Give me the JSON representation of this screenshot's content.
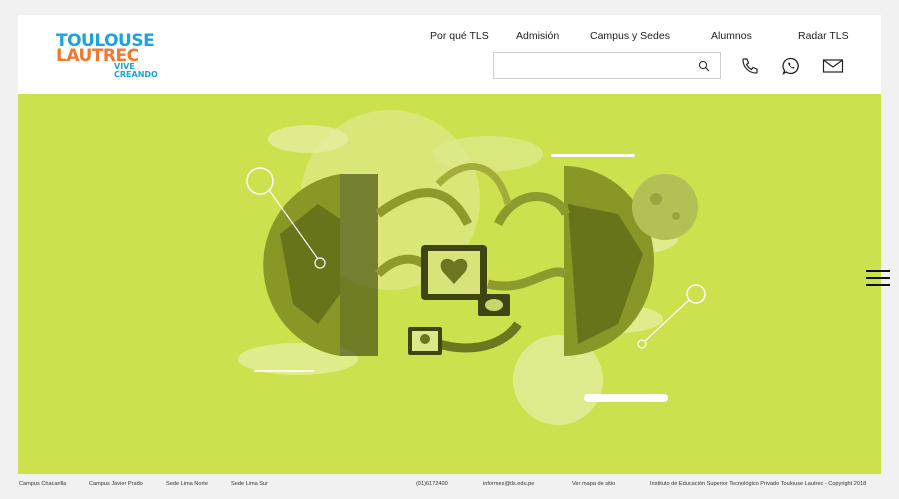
{
  "logo": {
    "line1": "TOULOUSE",
    "line2": "LAUTREC",
    "line3": "VIVE",
    "line4": "CREANDO",
    "brand_blue": "#1aa3e0",
    "brand_orange": "#f0772d"
  },
  "nav": {
    "items": [
      "Por qué TLS",
      "Admisión",
      "Campus y Sedes",
      "Alumnos",
      "Radar TLS"
    ]
  },
  "search": {
    "placeholder": "",
    "value": "",
    "icon": "search-icon"
  },
  "header_icons": [
    "phone-icon",
    "whatsapp-icon",
    "mail-icon"
  ],
  "hero": {
    "background": "#cde04d",
    "illustration": "globe-machine-heart-illustration"
  },
  "menu": {
    "icon": "hamburger-icon"
  },
  "footer": {
    "campus_links": [
      "Campus Chacarilla",
      "Campus Javier Prado",
      "Sede Lima Norte",
      "Sede Lima Sur"
    ],
    "phone": "(01)6172400",
    "email": "informes@tls.edu.pe",
    "sitemap": "Ver mapa de sitio",
    "copyright": "Instituto de Educación Superior Tecnológico Privado Toulouse Lautrec - Copyright 2018"
  }
}
